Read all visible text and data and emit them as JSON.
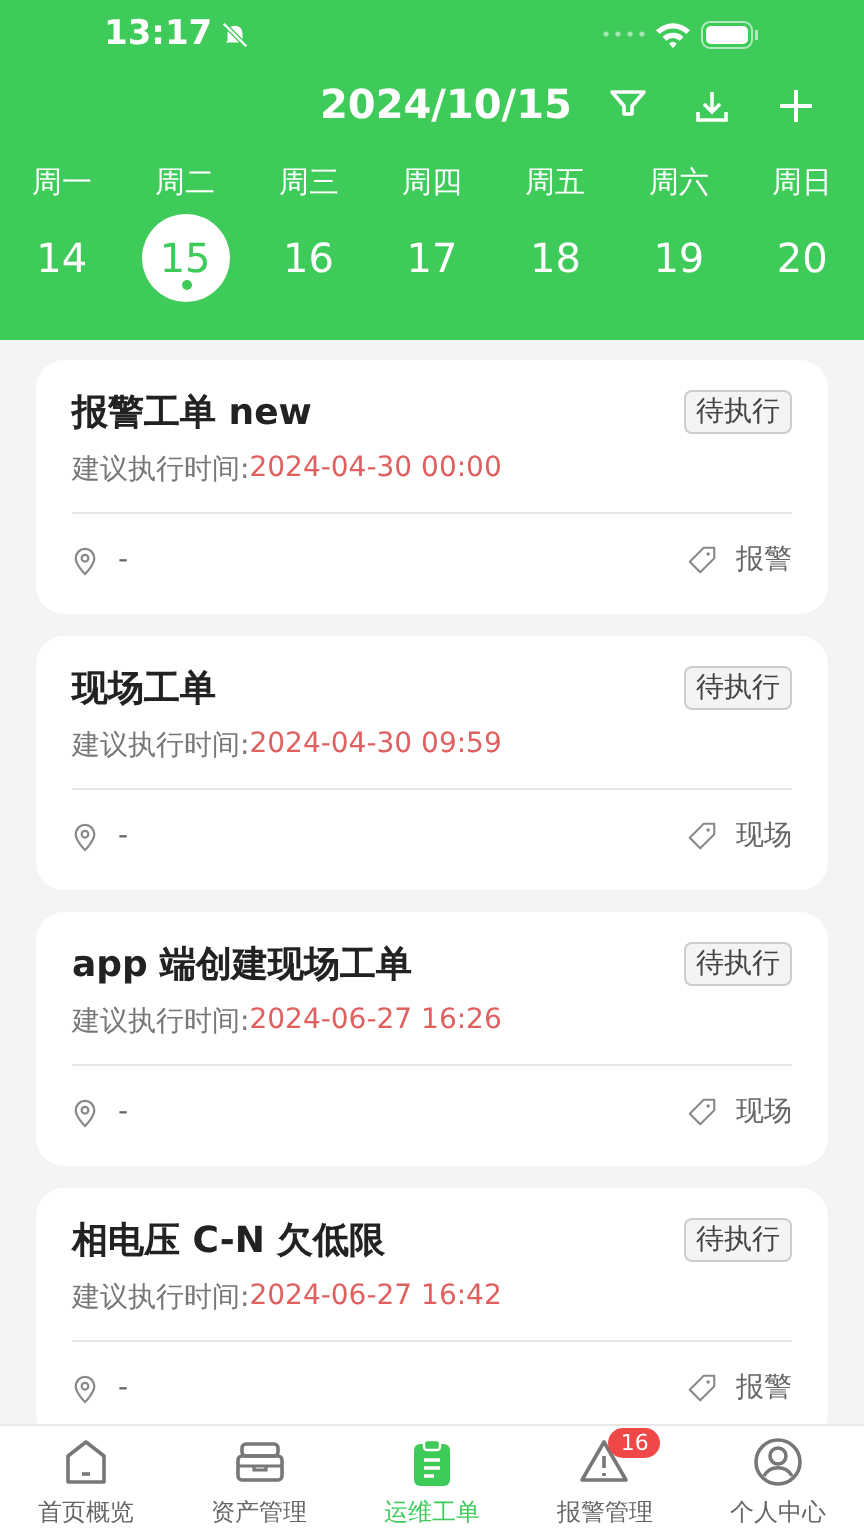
{
  "status_bar": {
    "time": "13:17"
  },
  "header": {
    "title": "2024/10/15"
  },
  "week": [
    {
      "weekday": "周一",
      "day": "14",
      "selected": false
    },
    {
      "weekday": "周二",
      "day": "15",
      "selected": true
    },
    {
      "weekday": "周三",
      "day": "16",
      "selected": false
    },
    {
      "weekday": "周四",
      "day": "17",
      "selected": false
    },
    {
      "weekday": "周五",
      "day": "18",
      "selected": false
    },
    {
      "weekday": "周六",
      "day": "19",
      "selected": false
    },
    {
      "weekday": "周日",
      "day": "20",
      "selected": false
    }
  ],
  "orders": [
    {
      "title": "报警工单 new",
      "status": "待执行",
      "time_label": "建议执行时间:",
      "time": "2024-04-30 00:00",
      "location": "-",
      "tag": "报警"
    },
    {
      "title": "现场工单",
      "status": "待执行",
      "time_label": "建议执行时间:",
      "time": "2024-04-30 09:59",
      "location": "-",
      "tag": "现场"
    },
    {
      "title": "app 端创建现场工单",
      "status": "待执行",
      "time_label": "建议执行时间:",
      "time": "2024-06-27 16:26",
      "location": "-",
      "tag": "现场"
    },
    {
      "title": "相电压 C-N 欠低限",
      "status": "待执行",
      "time_label": "建议执行时间:",
      "time": "2024-06-27 16:42",
      "location": "-",
      "tag": "报警"
    }
  ],
  "tab_bar": [
    {
      "kind": "home",
      "label": "首页概览",
      "selected": false
    },
    {
      "kind": "assets",
      "label": "资产管理",
      "selected": false
    },
    {
      "kind": "orders",
      "label": "运维工单",
      "selected": true
    },
    {
      "kind": "alarm",
      "label": "报警管理",
      "selected": false,
      "badge": "16"
    },
    {
      "kind": "profile",
      "label": "个人中心",
      "selected": false
    }
  ]
}
